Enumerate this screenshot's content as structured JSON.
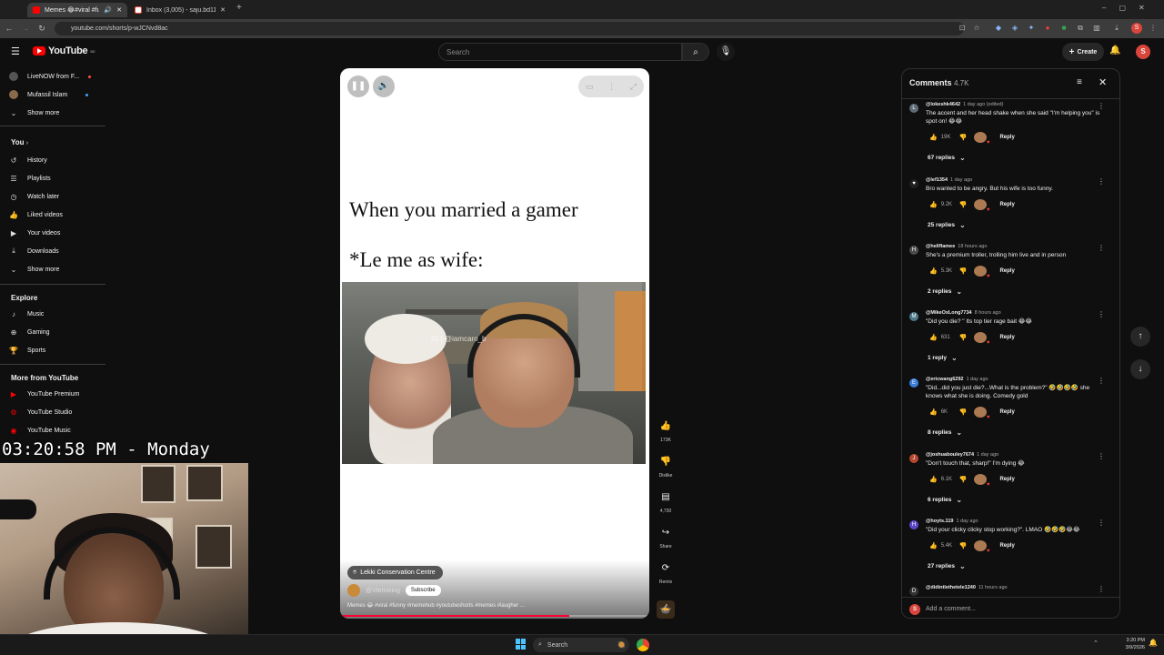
{
  "browser": {
    "tabs": [
      {
        "title": "Memes 😂#viral #funny #me",
        "active": true
      },
      {
        "title": "Inbox (3,005) - saju.bd113@gm",
        "active": false
      }
    ],
    "url": "youtube.com/shorts/p-wJCNvd8ac"
  },
  "header": {
    "logo": "YouTube",
    "logo_sup": "BD",
    "search_placeholder": "Search",
    "create_label": "Create",
    "avatar_letter": "S"
  },
  "sidebar": {
    "subs": [
      {
        "label": "LiveNOW from F...",
        "dot": "red"
      },
      {
        "label": "Mufassil Islam",
        "dot": "blue"
      },
      {
        "label": "Show more"
      }
    ],
    "you_heading": "You",
    "you_items": [
      "History",
      "Playlists",
      "Watch later",
      "Liked videos",
      "Your videos",
      "Downloads",
      "Show more"
    ],
    "explore_heading": "Explore",
    "explore_items": [
      "Music",
      "Gaming",
      "Sports"
    ],
    "more_heading": "More from YouTube",
    "more_items": [
      "YouTube Premium",
      "YouTube Studio",
      "YouTube Music"
    ]
  },
  "overlay": {
    "clock": "03:20:58 PM - Monday"
  },
  "short": {
    "line1": "When you married a gamer",
    "line2": "*Le me as wife:",
    "watermark": "IG | @iamcaro_b",
    "location": "Lekki Conservation Centre",
    "channel": "@Vtemixing",
    "subscribe": "Subscribe",
    "description": "Memes 😂 #viral #funny #memehub #youtubeshorts #memes #laugher ...",
    "progress": 0.74
  },
  "actions": {
    "likes": "173K",
    "dislike": "Dislike",
    "comments": "4,730",
    "share": "Share",
    "remix": "Remix"
  },
  "comments": {
    "title": "Comments",
    "count": "4.7K",
    "add_placeholder": "Add a comment...",
    "add_avatar": "S",
    "items": [
      {
        "user": "@lokeshk4642",
        "time": "1 day ago (edited)",
        "text": "The accent and her head shake when she said \"I'm helping you\" is spot on! 😂😂",
        "likes": "19K",
        "reply": "Reply",
        "replies": "67 replies",
        "avatar": "L",
        "color": "#5e6b74"
      },
      {
        "user": "@lef1354",
        "time": "1 day ago",
        "text": "Bro wanted to be angry. But his wife is too funny.",
        "likes": "9.2K",
        "reply": "Reply",
        "replies": "25 replies",
        "avatar": "♥",
        "color": "#202020"
      },
      {
        "user": "@hellflamee",
        "time": "18 hours ago",
        "text": "She's a premium troller, trolling him live and in person",
        "likes": "5.3K",
        "reply": "Reply",
        "replies": "2 replies",
        "avatar": "H",
        "color": "#4d4d4d"
      },
      {
        "user": "@MikeOxLong7734",
        "time": "8 hours ago",
        "text": "\"Did you die? \" Its top tier rage bait 😂😂",
        "likes": "631",
        "reply": "Reply",
        "replies": "1 reply",
        "avatar": "M",
        "color": "#4f7a8a"
      },
      {
        "user": "@ericwang6292",
        "time": "1 day ago",
        "text": "\"Did...did you just die?...What is the problem?\" 🤣🤣🤣🤣 she knows what she is doing. Comedy gold",
        "likes": "6K",
        "reply": "Reply",
        "replies": "8 replies",
        "avatar": "E",
        "color": "#3b7dd8"
      },
      {
        "user": "@joshuabouley7674",
        "time": "1 day ago",
        "text": "\"Don't touch that, sharp!\" I'm dying 😂",
        "likes": "6.1K",
        "reply": "Reply",
        "replies": "6 replies",
        "avatar": "J",
        "color": "#b5462f"
      },
      {
        "user": "@hoyts.119",
        "time": "1 day ago",
        "text": "\"Did your clicky clicky stop working?\". LMAO 🤣🤣🤣😂😂",
        "likes": "5.4K",
        "reply": "Reply",
        "replies": "27 replies",
        "avatar": "H",
        "color": "#5a48c8"
      },
      {
        "user": "@didintlethetele1240",
        "time": "11 hours ago",
        "text": "",
        "likes": "",
        "reply": "",
        "replies": "",
        "avatar": "D",
        "color": "#333"
      }
    ]
  },
  "taskbar": {
    "search": "Search",
    "time": "3:20 PM",
    "date": "3/9/2026"
  }
}
